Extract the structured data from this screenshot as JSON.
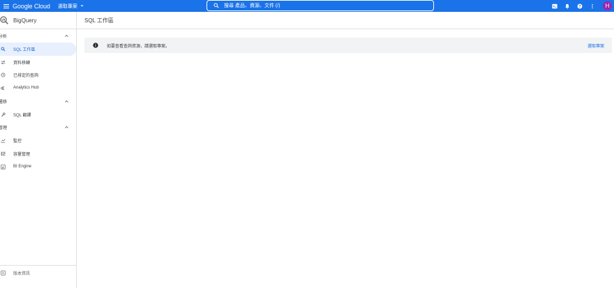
{
  "topbar": {
    "brand": "Google Cloud",
    "project": "選取專案",
    "search_text": "搜尋 產品、資源、文件 (/)",
    "avatar_letter": "H",
    "icons": [
      "menu-icon",
      "search-icon",
      "cloud-shell-icon",
      "notifications-icon",
      "help-icon",
      "more-vert-icon"
    ]
  },
  "sidebar": {
    "product": "BigQuery",
    "sections": [
      {
        "label": "分析",
        "items": [
          {
            "label": "SQL 工作區",
            "icon": "search-icon",
            "active": true
          },
          {
            "label": "資料移轉",
            "icon": "transfer-icon",
            "active": false
          },
          {
            "label": "已排定的查詢",
            "icon": "schedule-icon",
            "active": false
          },
          {
            "label": "Analytics Hub",
            "icon": "hub-icon",
            "active": false
          }
        ]
      },
      {
        "label": "遷移",
        "items": [
          {
            "label": "SQL 翻譯",
            "icon": "wrench-icon",
            "active": false
          }
        ]
      },
      {
        "label": "管理",
        "items": [
          {
            "label": "監控",
            "icon": "monitoring-icon",
            "active": false
          },
          {
            "label": "容量管理",
            "icon": "capacity-icon",
            "active": false
          },
          {
            "label": "BI Engine",
            "icon": "bi-engine-icon",
            "active": false
          }
        ]
      }
    ],
    "footer": "版本資訊"
  },
  "main": {
    "title": "SQL 工作區",
    "banner": {
      "text": "如要查看查詢資源，請選取專案。",
      "action": "選取專案"
    }
  },
  "colors": {
    "topbar": "#1a73e8",
    "active_bg": "#e8f0fe",
    "active_text": "#1967d2",
    "banner_bg": "#f1f3f4",
    "avatar": "#9c27b0"
  }
}
